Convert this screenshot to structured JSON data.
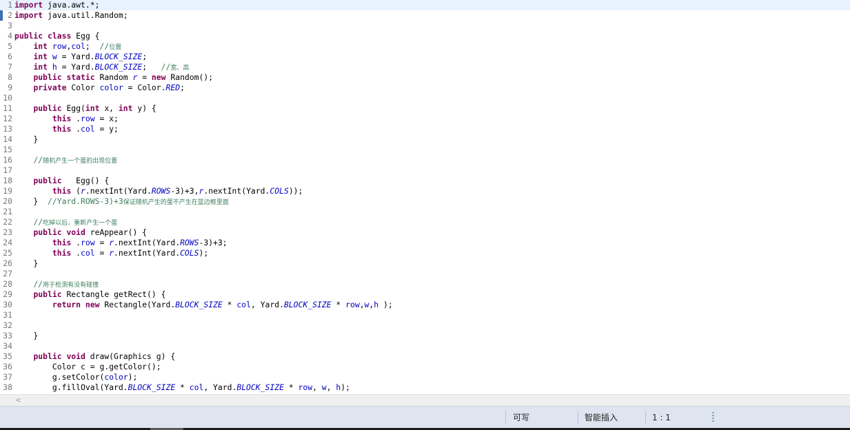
{
  "editor": {
    "lines": [
      {
        "n": "1",
        "tokens": [
          [
            "kw",
            "import"
          ],
          [
            "",
            "java.awt.*;"
          ]
        ]
      },
      {
        "n": "2",
        "tokens": [
          [
            "kw",
            "import"
          ],
          [
            "",
            "java.util.Random;"
          ]
        ]
      },
      {
        "n": "3",
        "tokens": []
      },
      {
        "n": "4",
        "tokens": [
          [
            "kw",
            "public"
          ],
          [
            "",
            ""
          ],
          [
            "kw",
            "class"
          ],
          [
            "",
            "Egg {"
          ]
        ]
      },
      {
        "n": "5",
        "tokens": [
          [
            "",
            "    "
          ],
          [
            "kw",
            "int"
          ],
          [
            "fld",
            "row"
          ],
          [
            "",
            ","
          ],
          [
            "fld",
            "col"
          ],
          [
            "",
            ";  "
          ],
          [
            "cmt",
            "//"
          ],
          [
            "cmt-cjk",
            "位置"
          ]
        ]
      },
      {
        "n": "6",
        "tokens": [
          [
            "",
            "    "
          ],
          [
            "kw",
            "int"
          ],
          [
            "fld",
            "w"
          ],
          [
            "",
            " = Yard."
          ],
          [
            "stat",
            "BLOCK_SIZE"
          ],
          [
            "",
            ";"
          ]
        ]
      },
      {
        "n": "7",
        "tokens": [
          [
            "",
            "    "
          ],
          [
            "kw",
            "int"
          ],
          [
            "fld",
            "h"
          ],
          [
            "",
            " = Yard."
          ],
          [
            "stat",
            "BLOCK_SIZE"
          ],
          [
            "",
            ";   "
          ],
          [
            "cmt",
            "//"
          ],
          [
            "cmt-cjk",
            "宽、高"
          ]
        ]
      },
      {
        "n": "8",
        "tokens": [
          [
            "",
            "    "
          ],
          [
            "kw",
            "public"
          ],
          [
            "",
            ""
          ],
          [
            "kw",
            "static"
          ],
          [
            "",
            "Random "
          ],
          [
            "stat",
            "r"
          ],
          [
            "",
            " = "
          ],
          [
            "kw",
            "new"
          ],
          [
            "",
            "Random();"
          ]
        ]
      },
      {
        "n": "9",
        "tokens": [
          [
            "",
            "    "
          ],
          [
            "kw",
            "private"
          ],
          [
            "",
            "Color "
          ],
          [
            "fld",
            "color"
          ],
          [
            "",
            " = Color."
          ],
          [
            "stat",
            "RED"
          ],
          [
            "",
            ";"
          ]
        ]
      },
      {
        "n": "10",
        "tokens": []
      },
      {
        "n": "11",
        "tokens": [
          [
            "",
            "    "
          ],
          [
            "kw",
            "public"
          ],
          [
            "",
            "Egg("
          ],
          [
            "kw",
            "int"
          ],
          [
            "",
            "x, "
          ],
          [
            "kw",
            "int"
          ],
          [
            "",
            "y) {"
          ]
        ]
      },
      {
        "n": "12",
        "tokens": [
          [
            "",
            "        "
          ],
          [
            "kw",
            "this"
          ],
          [
            "",
            "."
          ],
          [
            "fld",
            "row"
          ],
          [
            "",
            " = x;"
          ]
        ]
      },
      {
        "n": "13",
        "tokens": [
          [
            "",
            "        "
          ],
          [
            "kw",
            "this"
          ],
          [
            "",
            "."
          ],
          [
            "fld",
            "col"
          ],
          [
            "",
            " = y;"
          ]
        ]
      },
      {
        "n": "14",
        "tokens": [
          [
            "",
            "    }"
          ]
        ]
      },
      {
        "n": "15",
        "tokens": []
      },
      {
        "n": "16",
        "tokens": [
          [
            "",
            "    "
          ],
          [
            "cmt",
            "//"
          ],
          [
            "cmt-cjk",
            "随机产生一个蛋的出现位置"
          ]
        ]
      },
      {
        "n": "17",
        "tokens": []
      },
      {
        "n": "18",
        "tokens": [
          [
            "",
            "    "
          ],
          [
            "kw",
            "public"
          ],
          [
            "",
            "  Egg() {"
          ]
        ]
      },
      {
        "n": "19",
        "tokens": [
          [
            "",
            "        "
          ],
          [
            "kw",
            "this"
          ],
          [
            "",
            "("
          ],
          [
            "stat",
            "r"
          ],
          [
            "",
            ".nextInt(Yard."
          ],
          [
            "stat",
            "ROWS"
          ],
          [
            "",
            "-3)+3,"
          ],
          [
            "stat",
            "r"
          ],
          [
            "",
            ".nextInt(Yard."
          ],
          [
            "stat",
            "COLS"
          ],
          [
            "",
            "));"
          ]
        ]
      },
      {
        "n": "20",
        "tokens": [
          [
            "",
            "    }  "
          ],
          [
            "cmt",
            "//Yard.ROWS-3)+3"
          ],
          [
            "cmt-cjk",
            "保证随机产生的蛋不产生在蓝边框里面"
          ]
        ]
      },
      {
        "n": "21",
        "tokens": []
      },
      {
        "n": "22",
        "tokens": [
          [
            "",
            "    "
          ],
          [
            "cmt",
            "//"
          ],
          [
            "cmt-cjk",
            "吃掉以后，重新产生一个蛋"
          ]
        ]
      },
      {
        "n": "23",
        "tokens": [
          [
            "",
            "    "
          ],
          [
            "kw",
            "public"
          ],
          [
            "",
            ""
          ],
          [
            "kw",
            "void"
          ],
          [
            "",
            "reAppear() {"
          ]
        ]
      },
      {
        "n": "24",
        "tokens": [
          [
            "",
            "        "
          ],
          [
            "kw",
            "this"
          ],
          [
            "",
            "."
          ],
          [
            "fld",
            "row"
          ],
          [
            "",
            " = "
          ],
          [
            "stat",
            "r"
          ],
          [
            "",
            ".nextInt(Yard."
          ],
          [
            "stat",
            "ROWS"
          ],
          [
            "",
            "-3)+3;"
          ]
        ]
      },
      {
        "n": "25",
        "tokens": [
          [
            "",
            "        "
          ],
          [
            "kw",
            "this"
          ],
          [
            "",
            "."
          ],
          [
            "fld",
            "col"
          ],
          [
            "",
            " = "
          ],
          [
            "stat",
            "r"
          ],
          [
            "",
            ".nextInt(Yard."
          ],
          [
            "stat",
            "COLS"
          ],
          [
            "",
            ");"
          ]
        ]
      },
      {
        "n": "26",
        "tokens": [
          [
            "",
            "    }"
          ]
        ]
      },
      {
        "n": "27",
        "tokens": []
      },
      {
        "n": "28",
        "tokens": [
          [
            "",
            "    "
          ],
          [
            "cmt",
            "//"
          ],
          [
            "cmt-cjk",
            "用于检测有没有碰撞"
          ]
        ]
      },
      {
        "n": "29",
        "tokens": [
          [
            "",
            "    "
          ],
          [
            "kw",
            "public"
          ],
          [
            "",
            "Rectangle getRect() {"
          ]
        ]
      },
      {
        "n": "30",
        "tokens": [
          [
            "",
            "        "
          ],
          [
            "kw",
            "return"
          ],
          [
            "",
            ""
          ],
          [
            "kw",
            "new"
          ],
          [
            "",
            "Rectangle(Yard."
          ],
          [
            "stat",
            "BLOCK_SIZE"
          ],
          [
            "",
            " * "
          ],
          [
            "fld",
            "col"
          ],
          [
            "",
            ", Yard."
          ],
          [
            "stat",
            "BLOCK_SIZE"
          ],
          [
            "",
            " * "
          ],
          [
            "fld",
            "row"
          ],
          [
            "",
            ","
          ],
          [
            "fld",
            "w"
          ],
          [
            "",
            ","
          ],
          [
            "fld",
            "h"
          ],
          [
            "",
            " );"
          ]
        ]
      },
      {
        "n": "31",
        "tokens": []
      },
      {
        "n": "32",
        "tokens": []
      },
      {
        "n": "33",
        "tokens": [
          [
            "",
            "    }"
          ]
        ]
      },
      {
        "n": "34",
        "tokens": []
      },
      {
        "n": "35",
        "tokens": [
          [
            "",
            "    "
          ],
          [
            "kw",
            "public"
          ],
          [
            "",
            ""
          ],
          [
            "kw",
            "void"
          ],
          [
            "",
            "draw(Graphics g) {"
          ]
        ]
      },
      {
        "n": "36",
        "tokens": [
          [
            "",
            "        Color c = g.getColor();"
          ]
        ]
      },
      {
        "n": "37",
        "tokens": [
          [
            "",
            "        g.setColor("
          ],
          [
            "fld",
            "color"
          ],
          [
            "",
            ");"
          ]
        ]
      },
      {
        "n": "38",
        "tokens": [
          [
            "",
            "        g.fillOval(Yard."
          ],
          [
            "stat",
            "BLOCK_SIZE"
          ],
          [
            "",
            " * "
          ],
          [
            "fld",
            "col"
          ],
          [
            "",
            ", Yard."
          ],
          [
            "stat",
            "BLOCK_SIZE"
          ],
          [
            "",
            " * "
          ],
          [
            "fld",
            "row"
          ],
          [
            "",
            ", "
          ],
          [
            "fld",
            "w"
          ],
          [
            "",
            ", "
          ],
          [
            "fld",
            "h"
          ],
          [
            "",
            ");"
          ]
        ]
      }
    ]
  },
  "hscroll": {
    "left_arrow": "<"
  },
  "status": {
    "write_mode": "可写",
    "insert_mode": "智能插入",
    "cursor_pos": "1 : 1"
  }
}
